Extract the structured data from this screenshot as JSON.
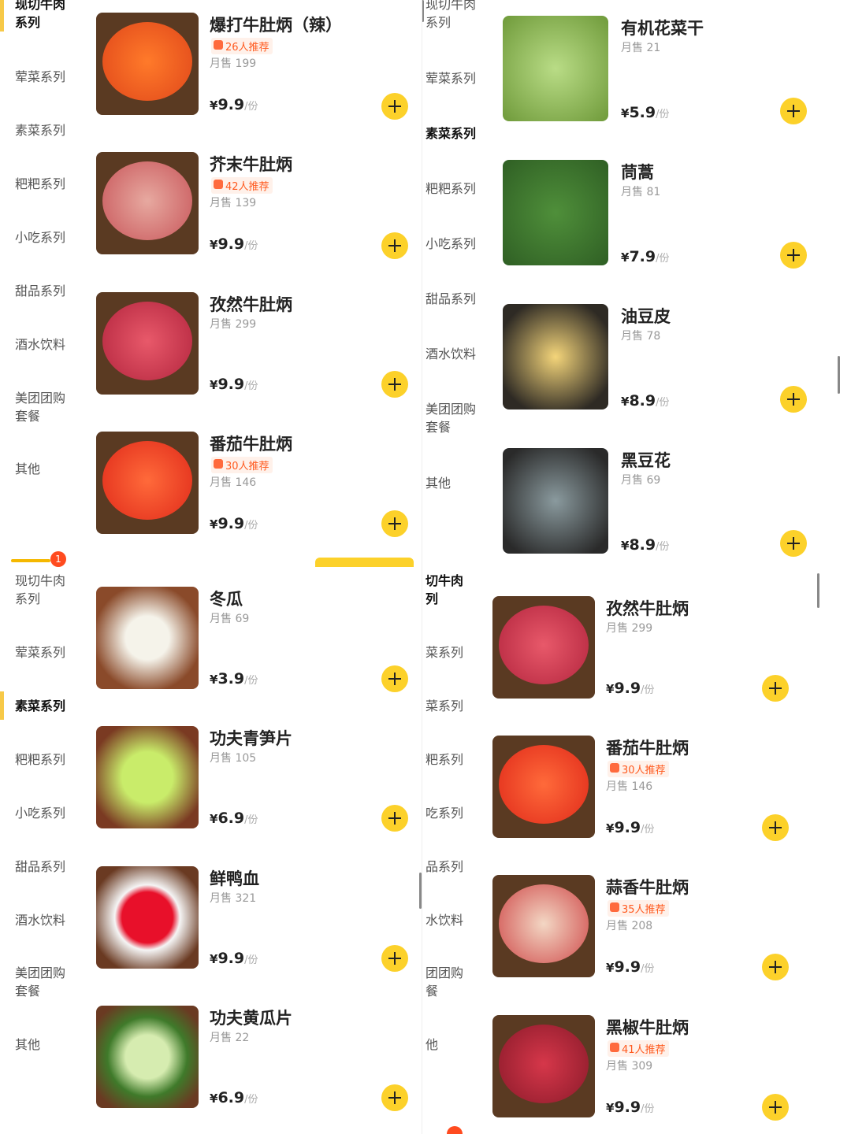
{
  "unit_suffix": "/份",
  "currency": "¥",
  "colors": {
    "accent": "#fcd12a",
    "badge": "#ff4b1f",
    "recommend": "#ff5a1f"
  },
  "panels": {
    "top_left": {
      "sidebar": [
        "现切牛肉\n系列",
        "荤菜系列",
        "素菜系列",
        "粑粑系列",
        "小吃系列",
        "甜品系列",
        "酒水饮料",
        "美团团购\n套餐",
        "其他"
      ],
      "products": [
        {
          "name": "爆打牛肚炳（辣）",
          "recommend": "26人推荐",
          "sales": "月售 199",
          "price": "9.9"
        },
        {
          "name": "芥末牛肚炳",
          "recommend": "42人推荐",
          "sales": "月售 139",
          "price": "9.9"
        },
        {
          "name": "孜然牛肚炳",
          "recommend": "",
          "sales": "月售 299",
          "price": "9.9"
        },
        {
          "name": "番茄牛肚炳",
          "recommend": "30人推荐",
          "sales": "月售 146",
          "price": "9.9"
        }
      ]
    },
    "top_right": {
      "sidebar": [
        "现切牛肉\n系列",
        "荤菜系列",
        "素菜系列",
        "粑粑系列",
        "小吃系列",
        "甜品系列",
        "酒水饮料",
        "美团团购\n套餐",
        "其他"
      ],
      "products": [
        {
          "name": "有机花菜干",
          "recommend": "",
          "sales": "月售 21",
          "price": "5.9"
        },
        {
          "name": "茼蒿",
          "recommend": "",
          "sales": "月售 81",
          "price": "7.9"
        },
        {
          "name": "油豆皮",
          "recommend": "",
          "sales": "月售 78",
          "price": "8.9"
        },
        {
          "name": "黑豆花",
          "recommend": "",
          "sales": "月售 69",
          "price": "8.9"
        }
      ]
    },
    "bottom_left": {
      "cart_count": "1",
      "sidebar": [
        "现切牛肉\n系列",
        "荤菜系列",
        "素菜系列",
        "粑粑系列",
        "小吃系列",
        "甜品系列",
        "酒水饮料",
        "美团团购\n套餐",
        "其他"
      ],
      "products": [
        {
          "name": "冬瓜",
          "recommend": "",
          "sales": "月售 69",
          "price": "3.9"
        },
        {
          "name": "功夫青笋片",
          "recommend": "",
          "sales": "月售 105",
          "price": "6.9"
        },
        {
          "name": "鲜鸭血",
          "recommend": "",
          "sales": "月售 321",
          "price": "9.9"
        },
        {
          "name": "功夫黄瓜片",
          "recommend": "",
          "sales": "月售 22",
          "price": "6.9"
        }
      ]
    },
    "bottom_right": {
      "sidebar": [
        "切牛肉\n列",
        "菜系列",
        "菜系列",
        "粑系列",
        "吃系列",
        "品系列",
        "水饮料",
        "团团购\n餐",
        "他"
      ],
      "products": [
        {
          "name": "孜然牛肚炳",
          "recommend": "",
          "sales": "月售 299",
          "price": "9.9"
        },
        {
          "name": "番茄牛肚炳",
          "recommend": "30人推荐",
          "sales": "月售 146",
          "price": "9.9"
        },
        {
          "name": "蒜香牛肚炳",
          "recommend": "35人推荐",
          "sales": "月售 208",
          "price": "9.9"
        },
        {
          "name": "黑椒牛肚炳",
          "recommend": "41人推荐",
          "sales": "月售 309",
          "price": "9.9"
        }
      ]
    }
  }
}
